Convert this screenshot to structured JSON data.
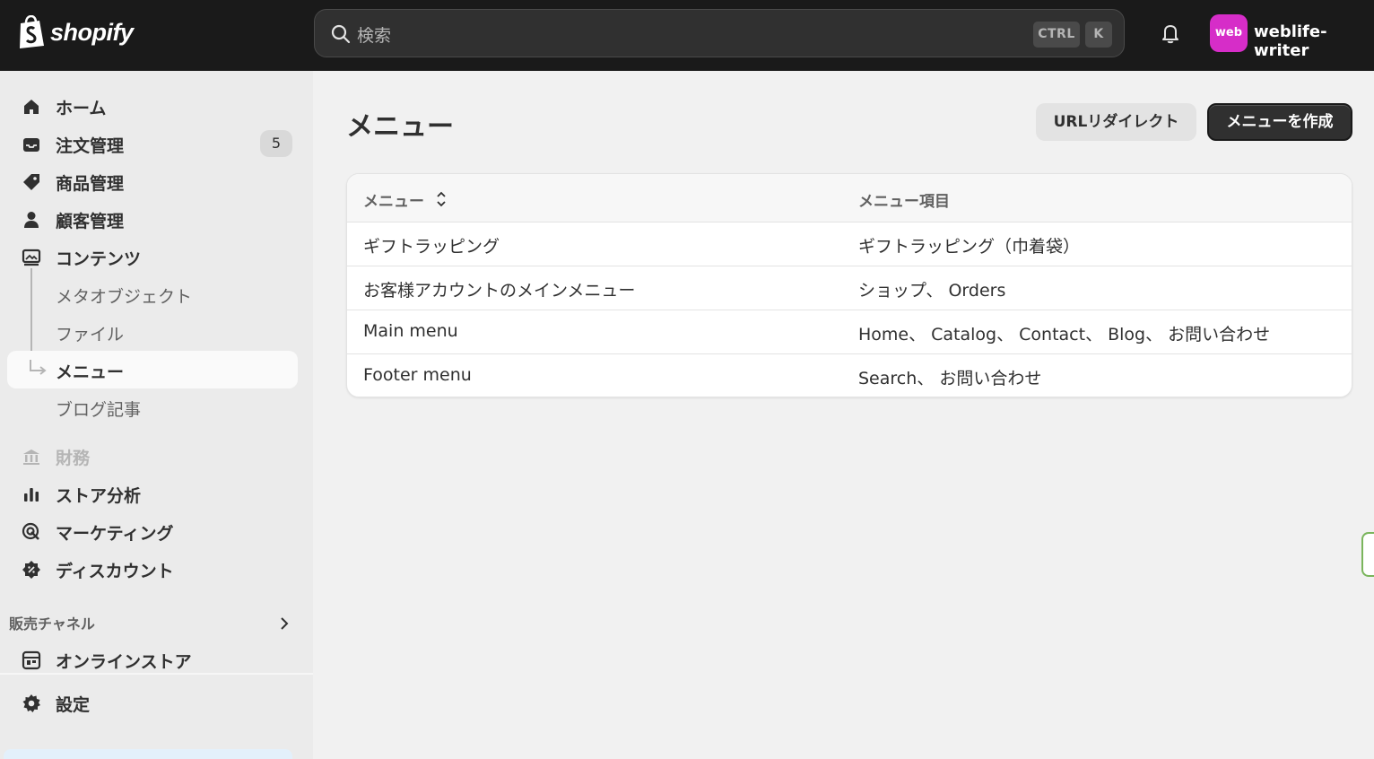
{
  "app": {
    "logo_text": "shopify"
  },
  "search": {
    "placeholder": "検索",
    "kbd_ctrl": "CTRL",
    "kbd_k": "K"
  },
  "account": {
    "avatar_text": "web",
    "store_name": "weblife-writer",
    "avatar_color": "#d62dc8"
  },
  "sidebar": {
    "items": [
      {
        "label": "ホーム",
        "icon": "home-icon"
      },
      {
        "label": "注文管理",
        "icon": "inbox-icon",
        "badge": "5"
      },
      {
        "label": "商品管理",
        "icon": "tag-icon"
      },
      {
        "label": "顧客管理",
        "icon": "person-icon"
      },
      {
        "label": "コンテンツ",
        "icon": "content-icon"
      },
      {
        "label": "メタオブジェクト"
      },
      {
        "label": "ファイル"
      },
      {
        "label": "メニュー",
        "active": true
      },
      {
        "label": "ブログ記事"
      },
      {
        "label": "財務",
        "icon": "bank-icon",
        "disabled": true
      },
      {
        "label": "ストア分析",
        "icon": "bar-chart-icon"
      },
      {
        "label": "マーケティング",
        "icon": "target-icon"
      },
      {
        "label": "ディスカウント",
        "icon": "discount-icon"
      }
    ],
    "sales_channels_label": "販売チャネル",
    "online_store_label": "オンラインストア",
    "settings_label": "設定"
  },
  "main": {
    "title": "メニュー",
    "url_redirect_label": "URLリダイレクト",
    "create_menu_label": "メニューを作成",
    "table": {
      "columns": [
        "メニュー",
        "メニュー項目"
      ],
      "rows": [
        {
          "name": "ギフトラッピング",
          "items": "ギフトラッピング（巾着袋）"
        },
        {
          "name": "お客様アカウントのメインメニュー",
          "items": "ショップ、 Orders"
        },
        {
          "name": "Main menu",
          "items": "Home、 Catalog、 Contact、 Blog、 お問い合わせ"
        },
        {
          "name": "Footer menu",
          "items": "Search、 お問い合わせ"
        }
      ]
    }
  },
  "colors": {
    "topbar": "#1a1a1a",
    "sidebar": "#ebebeb",
    "primary_button": "#303030"
  }
}
